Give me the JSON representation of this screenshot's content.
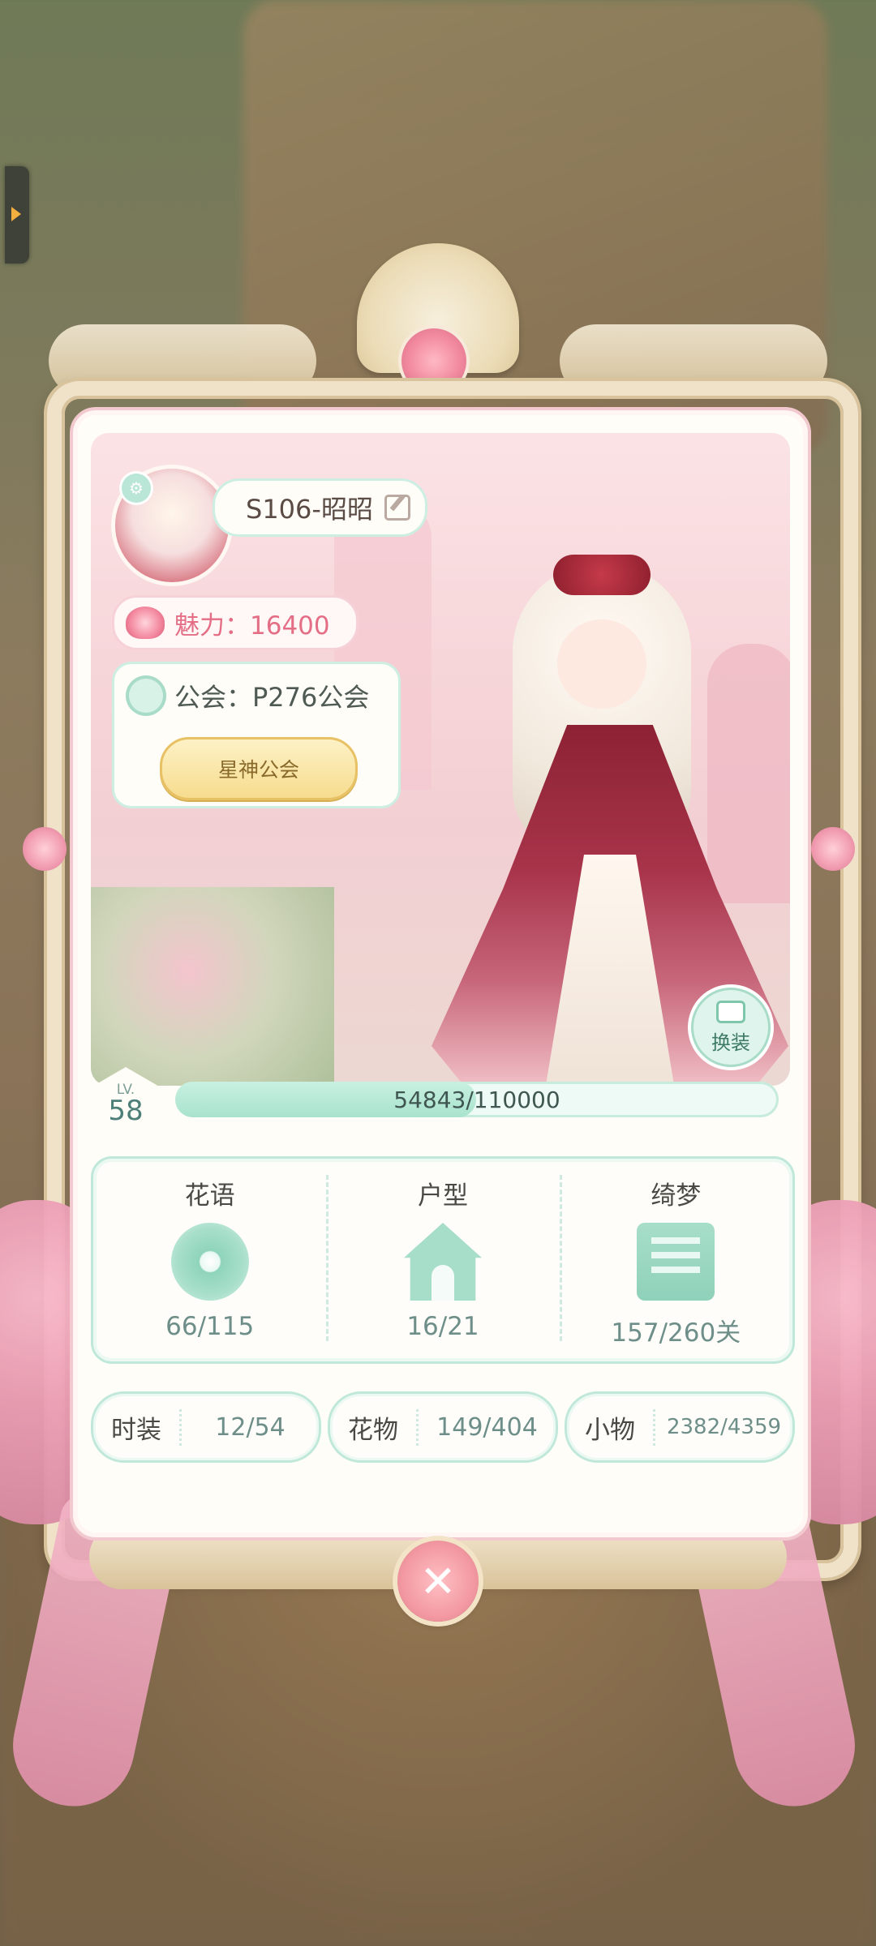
{
  "player": {
    "name": "S106-昭昭",
    "charm": "魅力：16400",
    "guild": "公会：P276公会",
    "guild_title": "星神公会"
  },
  "actions": {
    "change_outfit": "换装",
    "close": "✕"
  },
  "level": {
    "lv_label": "LV.",
    "value": "58",
    "xp_text": "54843/110000",
    "xp_fraction": 0.4985
  },
  "stats": [
    {
      "title": "花语",
      "value": "66/115",
      "icon": "flower-icon"
    },
    {
      "title": "户型",
      "value": "16/21",
      "icon": "house-icon"
    },
    {
      "title": "绮梦",
      "value": "157/260关",
      "icon": "letter-quill-icon"
    }
  ],
  "collections": [
    {
      "label": "时装",
      "value": "12/54"
    },
    {
      "label": "花物",
      "value": "149/404"
    },
    {
      "label": "小物",
      "value": "2382/4359"
    }
  ]
}
